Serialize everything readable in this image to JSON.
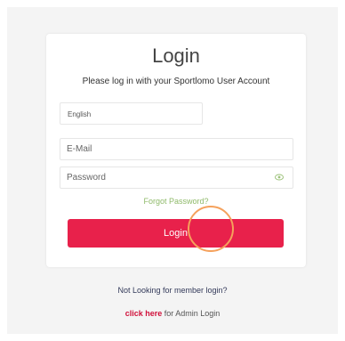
{
  "login": {
    "title": "Login",
    "subtitle": "Please log in with your Sportlomo User Account",
    "language": "English",
    "email_placeholder": "E-Mail",
    "password_placeholder": "Password",
    "forgot_label": "Forgot Password?",
    "login_button": "Login"
  },
  "footer": {
    "not_looking": "Not Looking for member login?",
    "click_here": "click here",
    "admin_suffix": " for Admin Login"
  },
  "colors": {
    "accent": "#e8214b",
    "forgot": "#8fba6a",
    "link": "#d0103a",
    "highlight_ring": "#f5a15c"
  },
  "icons": {
    "show_password": "eye-icon"
  }
}
